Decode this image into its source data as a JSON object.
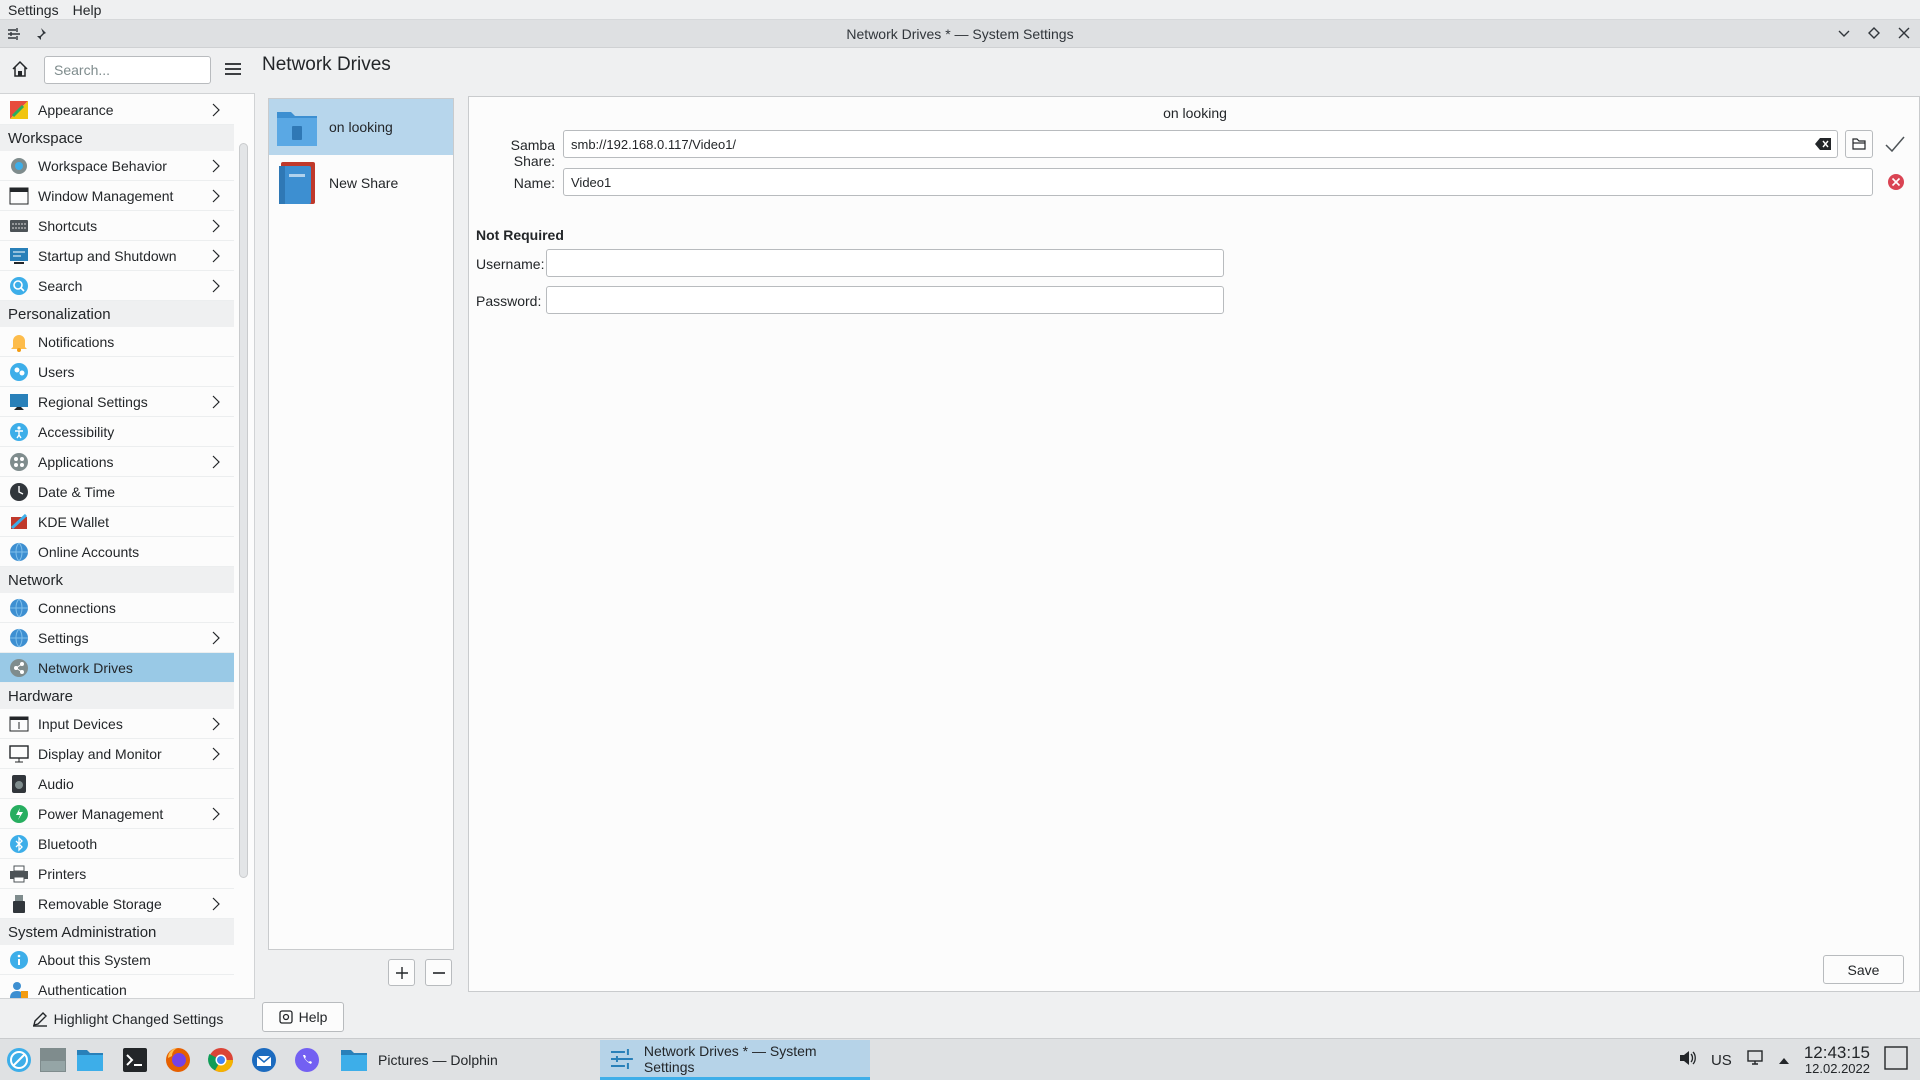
{
  "menubar": {
    "items": [
      "Settings",
      "Help"
    ]
  },
  "window": {
    "title": "Network Drives * — System Settings"
  },
  "sidebar": {
    "search_placeholder": "Search...",
    "highlight_label": "Highlight Changed Settings",
    "entries": [
      {
        "type": "item",
        "label": "Appearance",
        "icon": "appearance-icon",
        "chevron": true
      },
      {
        "type": "cat",
        "label": "Workspace"
      },
      {
        "type": "item",
        "label": "Workspace Behavior",
        "icon": "workspace-icon",
        "chevron": true
      },
      {
        "type": "item",
        "label": "Window Management",
        "icon": "window-icon",
        "chevron": true
      },
      {
        "type": "item",
        "label": "Shortcuts",
        "icon": "keyboard-icon",
        "chevron": true
      },
      {
        "type": "item",
        "label": "Startup and Shutdown",
        "icon": "startup-icon",
        "chevron": true
      },
      {
        "type": "item",
        "label": "Search",
        "icon": "search-icon",
        "chevron": true
      },
      {
        "type": "cat",
        "label": "Personalization"
      },
      {
        "type": "item",
        "label": "Notifications",
        "icon": "bell-icon",
        "chevron": false
      },
      {
        "type": "item",
        "label": "Users",
        "icon": "users-icon",
        "chevron": false
      },
      {
        "type": "item",
        "label": "Regional Settings",
        "icon": "regional-icon",
        "chevron": true
      },
      {
        "type": "item",
        "label": "Accessibility",
        "icon": "accessibility-icon",
        "chevron": false
      },
      {
        "type": "item",
        "label": "Applications",
        "icon": "applications-icon",
        "chevron": true
      },
      {
        "type": "item",
        "label": "Date & Time",
        "icon": "clock-icon",
        "chevron": false
      },
      {
        "type": "item",
        "label": "KDE Wallet",
        "icon": "wallet-icon",
        "chevron": false
      },
      {
        "type": "item",
        "label": "Online Accounts",
        "icon": "globe-icon",
        "chevron": false
      },
      {
        "type": "cat",
        "label": "Network"
      },
      {
        "type": "item",
        "label": "Connections",
        "icon": "globe-icon",
        "chevron": false
      },
      {
        "type": "item",
        "label": "Settings",
        "icon": "globe-icon",
        "chevron": true
      },
      {
        "type": "item",
        "label": "Network Drives",
        "icon": "share-icon",
        "chevron": false,
        "selected": true
      },
      {
        "type": "cat",
        "label": "Hardware"
      },
      {
        "type": "item",
        "label": "Input Devices",
        "icon": "input-icon",
        "chevron": true
      },
      {
        "type": "item",
        "label": "Display and Monitor",
        "icon": "monitor-icon",
        "chevron": true
      },
      {
        "type": "item",
        "label": "Audio",
        "icon": "speaker-icon",
        "chevron": false
      },
      {
        "type": "item",
        "label": "Power Management",
        "icon": "power-icon",
        "chevron": true
      },
      {
        "type": "item",
        "label": "Bluetooth",
        "icon": "bluetooth-icon",
        "chevron": false
      },
      {
        "type": "item",
        "label": "Printers",
        "icon": "printer-icon",
        "chevron": false
      },
      {
        "type": "item",
        "label": "Removable Storage",
        "icon": "usb-icon",
        "chevron": true
      },
      {
        "type": "cat",
        "label": "System Administration"
      },
      {
        "type": "item",
        "label": "About this System",
        "icon": "info-icon",
        "chevron": false
      },
      {
        "type": "item",
        "label": "Authentication",
        "icon": "auth-icon",
        "chevron": false
      }
    ]
  },
  "main": {
    "title": "Network Drives",
    "shares": [
      {
        "label": "on looking",
        "selected": true,
        "icon": "folder-icon"
      },
      {
        "label": "New Share",
        "selected": false,
        "icon": "book-icon"
      }
    ],
    "detail": {
      "header": "on looking",
      "samba_label": "Samba Share:",
      "samba_value": "smb://192.168.0.117/Video1/",
      "name_label": "Name:",
      "name_value": "Video1",
      "not_required": "Not Required",
      "username_label": "Username:",
      "username_value": "",
      "password_label": "Password:",
      "password_value": ""
    },
    "save_label": "Save",
    "help_label": "Help"
  },
  "taskbar": {
    "tasks": [
      {
        "label": "Pictures — Dolphin",
        "active": false
      },
      {
        "label": "Network Drives * — System Settings",
        "active": true
      }
    ],
    "keyboard_layout": "US",
    "time": "12:43:15",
    "date": "12.02.2022"
  },
  "colors": {
    "accent": "#3daee9",
    "selection": "#99c9e6"
  }
}
